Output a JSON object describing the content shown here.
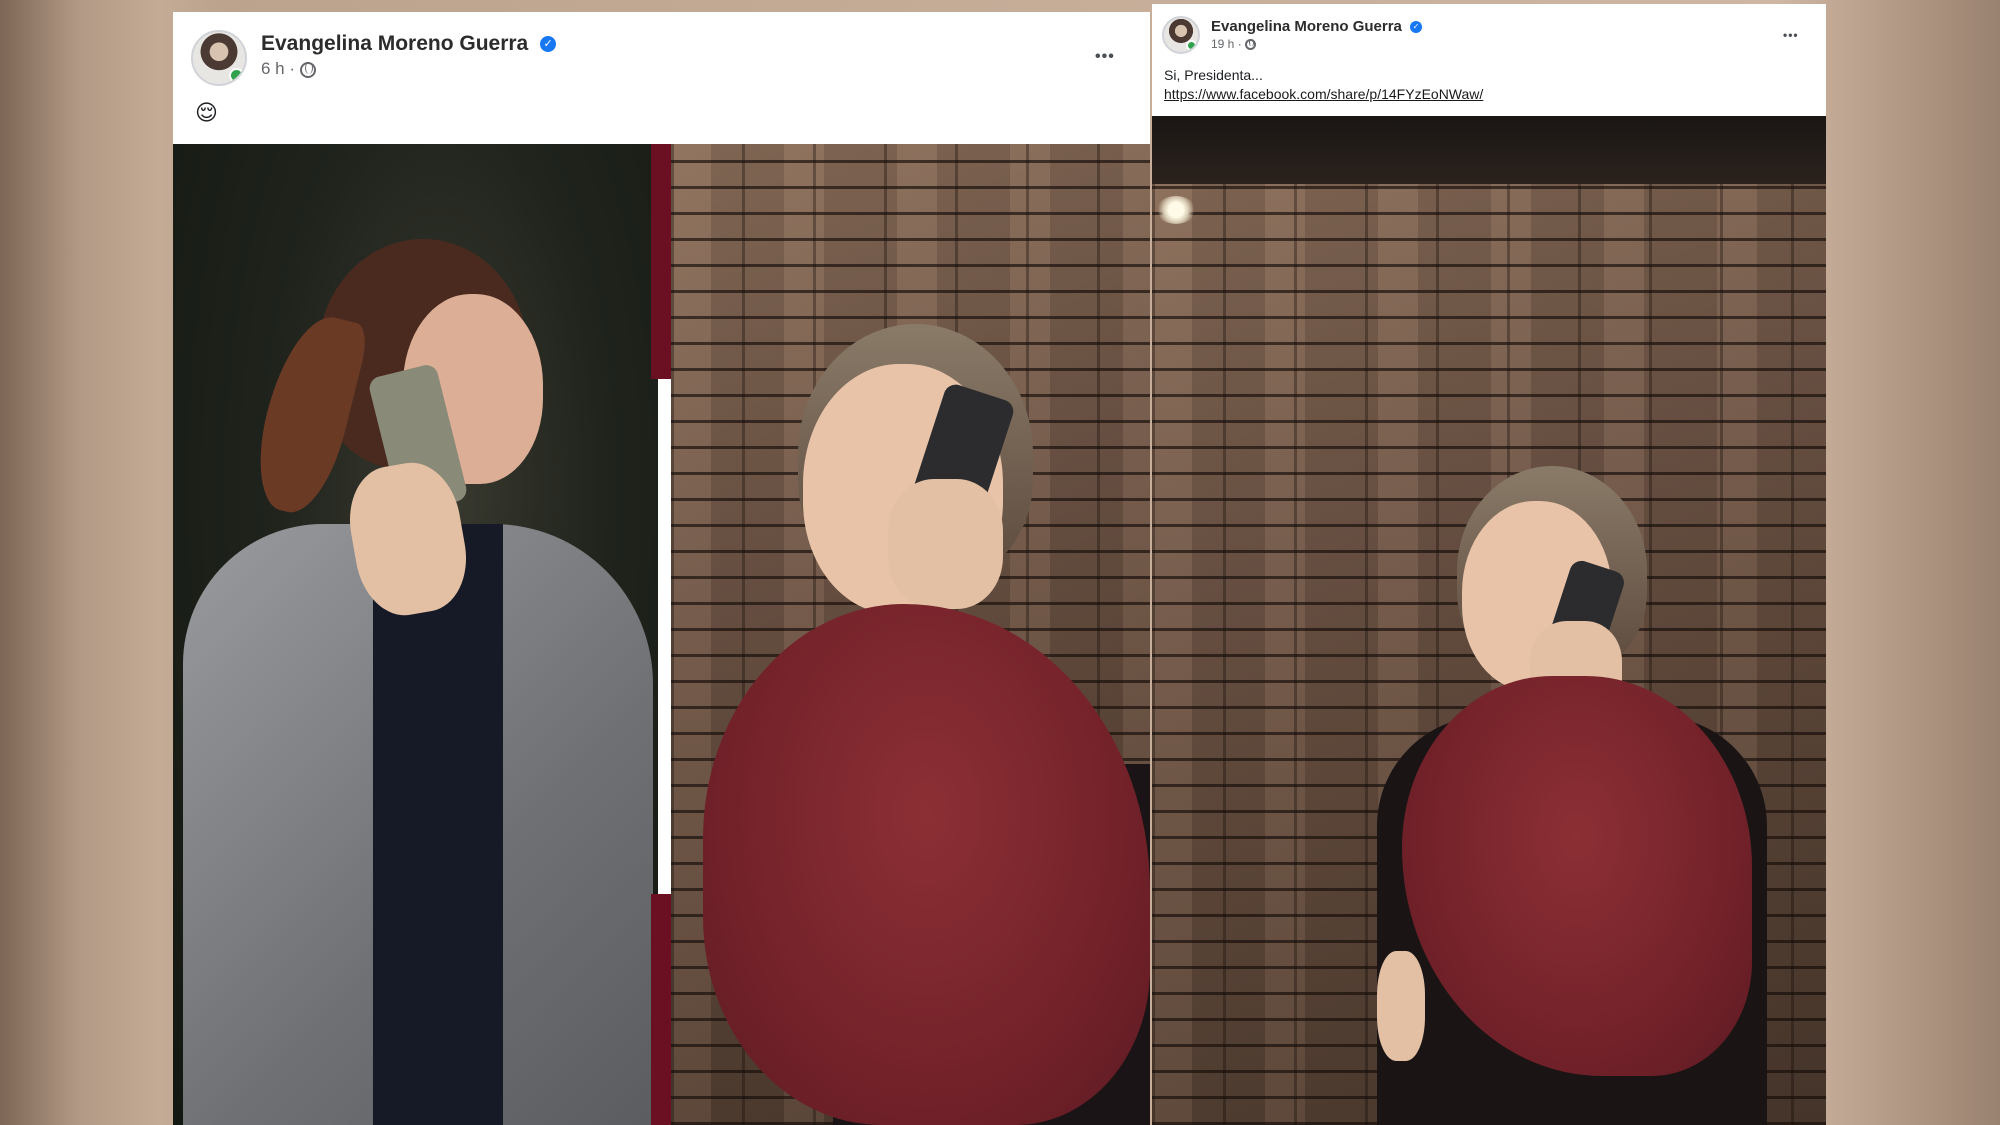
{
  "left_post": {
    "author": "Evangelina Moreno Guerra",
    "time": "6 h",
    "separator": "·",
    "body_emoji": "😌",
    "more_label": "•••"
  },
  "right_post": {
    "author": "Evangelina Moreno Guerra",
    "time": "19 h",
    "separator": "·",
    "body_text": "Si, Presidenta...",
    "link_text": "https://www.facebook.com/share/p/14FYzEoNWaw/",
    "more_label": "•••"
  },
  "icons": {
    "verified": "verified-badge-icon",
    "audience": "globe-icon",
    "more": "more-options-icon"
  },
  "colors": {
    "verified_blue": "#1877f2",
    "online_green": "#31a24c",
    "accent_red": "#6b0f22",
    "scarf_red": "#74222a"
  }
}
